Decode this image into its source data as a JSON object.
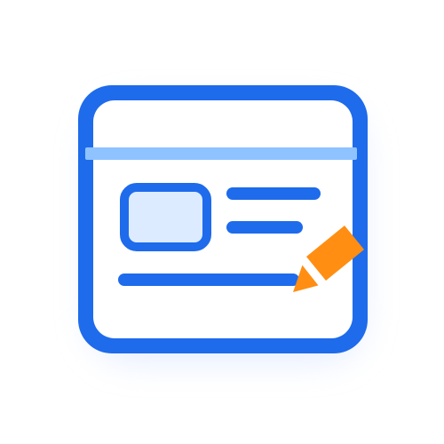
{
  "icon": {
    "name": "edit-card-icon",
    "colors": {
      "frame": "#1E6BEB",
      "panel": "#FFFFFF",
      "divider": "#8EC3FF",
      "thumb_fill": "#DCEBFF",
      "lines": "#1E6BEB",
      "pencil_body": "#FF8E12",
      "pencil_tip": "#FF8E12",
      "shadow": "#DDE8FF"
    }
  }
}
